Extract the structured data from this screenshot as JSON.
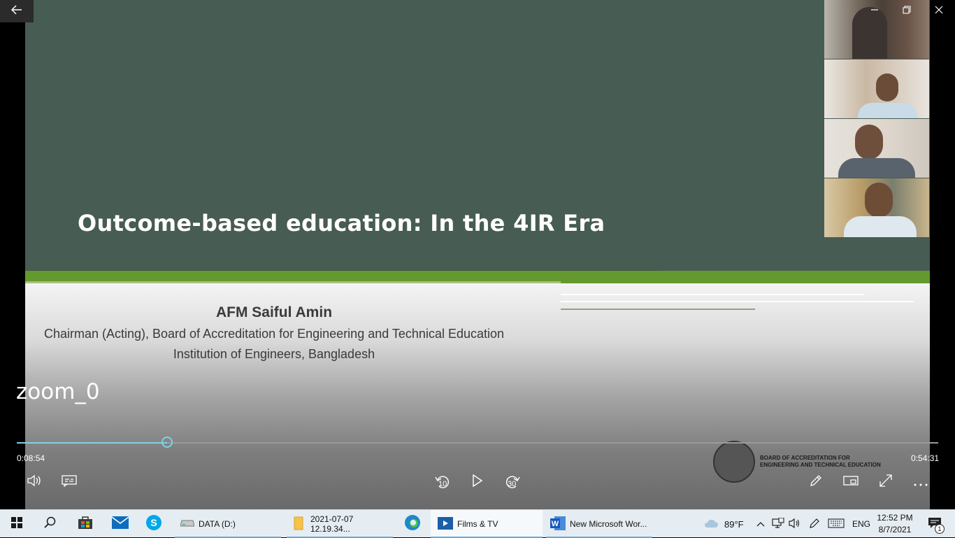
{
  "window": {
    "back_icon": "arrow-left-icon",
    "minimize_icon": "minimize-icon",
    "restore_icon": "restore-icon",
    "close_icon": "close-icon"
  },
  "slide": {
    "title": "Outcome-based education: In the 4IR Era",
    "presenter_name": "AFM Saiful Amin",
    "presenter_role": "Chairman (Acting), Board of Accreditation for Engineering and Technical Education",
    "presenter_org": "Institution of Engineers, Bangladesh",
    "logo_text_line1": "BOARD OF ACCREDITATION FOR",
    "logo_text_line2": "ENGINEERING AND TECHNICAL EDUCATION"
  },
  "player": {
    "file_label": "zoom_0",
    "current_time": "0:08:54",
    "total_time": "0:54:31",
    "progress": 0.163,
    "volume_icon": "volume-icon",
    "subtitles_icon": "subtitles-icon",
    "skip_back_label": "10",
    "skip_forward_label": "30",
    "play_icon": "play-icon",
    "edit_icon": "pencil-icon",
    "miniview_icon": "mini-view-icon",
    "fullscreen_icon": "fullscreen-icon",
    "more_icon": "more-icon"
  },
  "taskbar": {
    "start_icon": "windows-icon",
    "search_icon": "search-icon",
    "apps": [
      {
        "label": "DATA (D:)",
        "icon": "drive-icon"
      },
      {
        "label": "2021-07-07 12.19.34...",
        "icon": "folder-icon"
      },
      {
        "label": "Films & TV",
        "icon": "films-tv-icon"
      },
      {
        "label": "New Microsoft Wor...",
        "icon": "word-icon"
      }
    ],
    "weather": "89°F",
    "language": "ENG",
    "time": "12:52 PM",
    "date": "8/7/2021",
    "notification_count": "1"
  }
}
